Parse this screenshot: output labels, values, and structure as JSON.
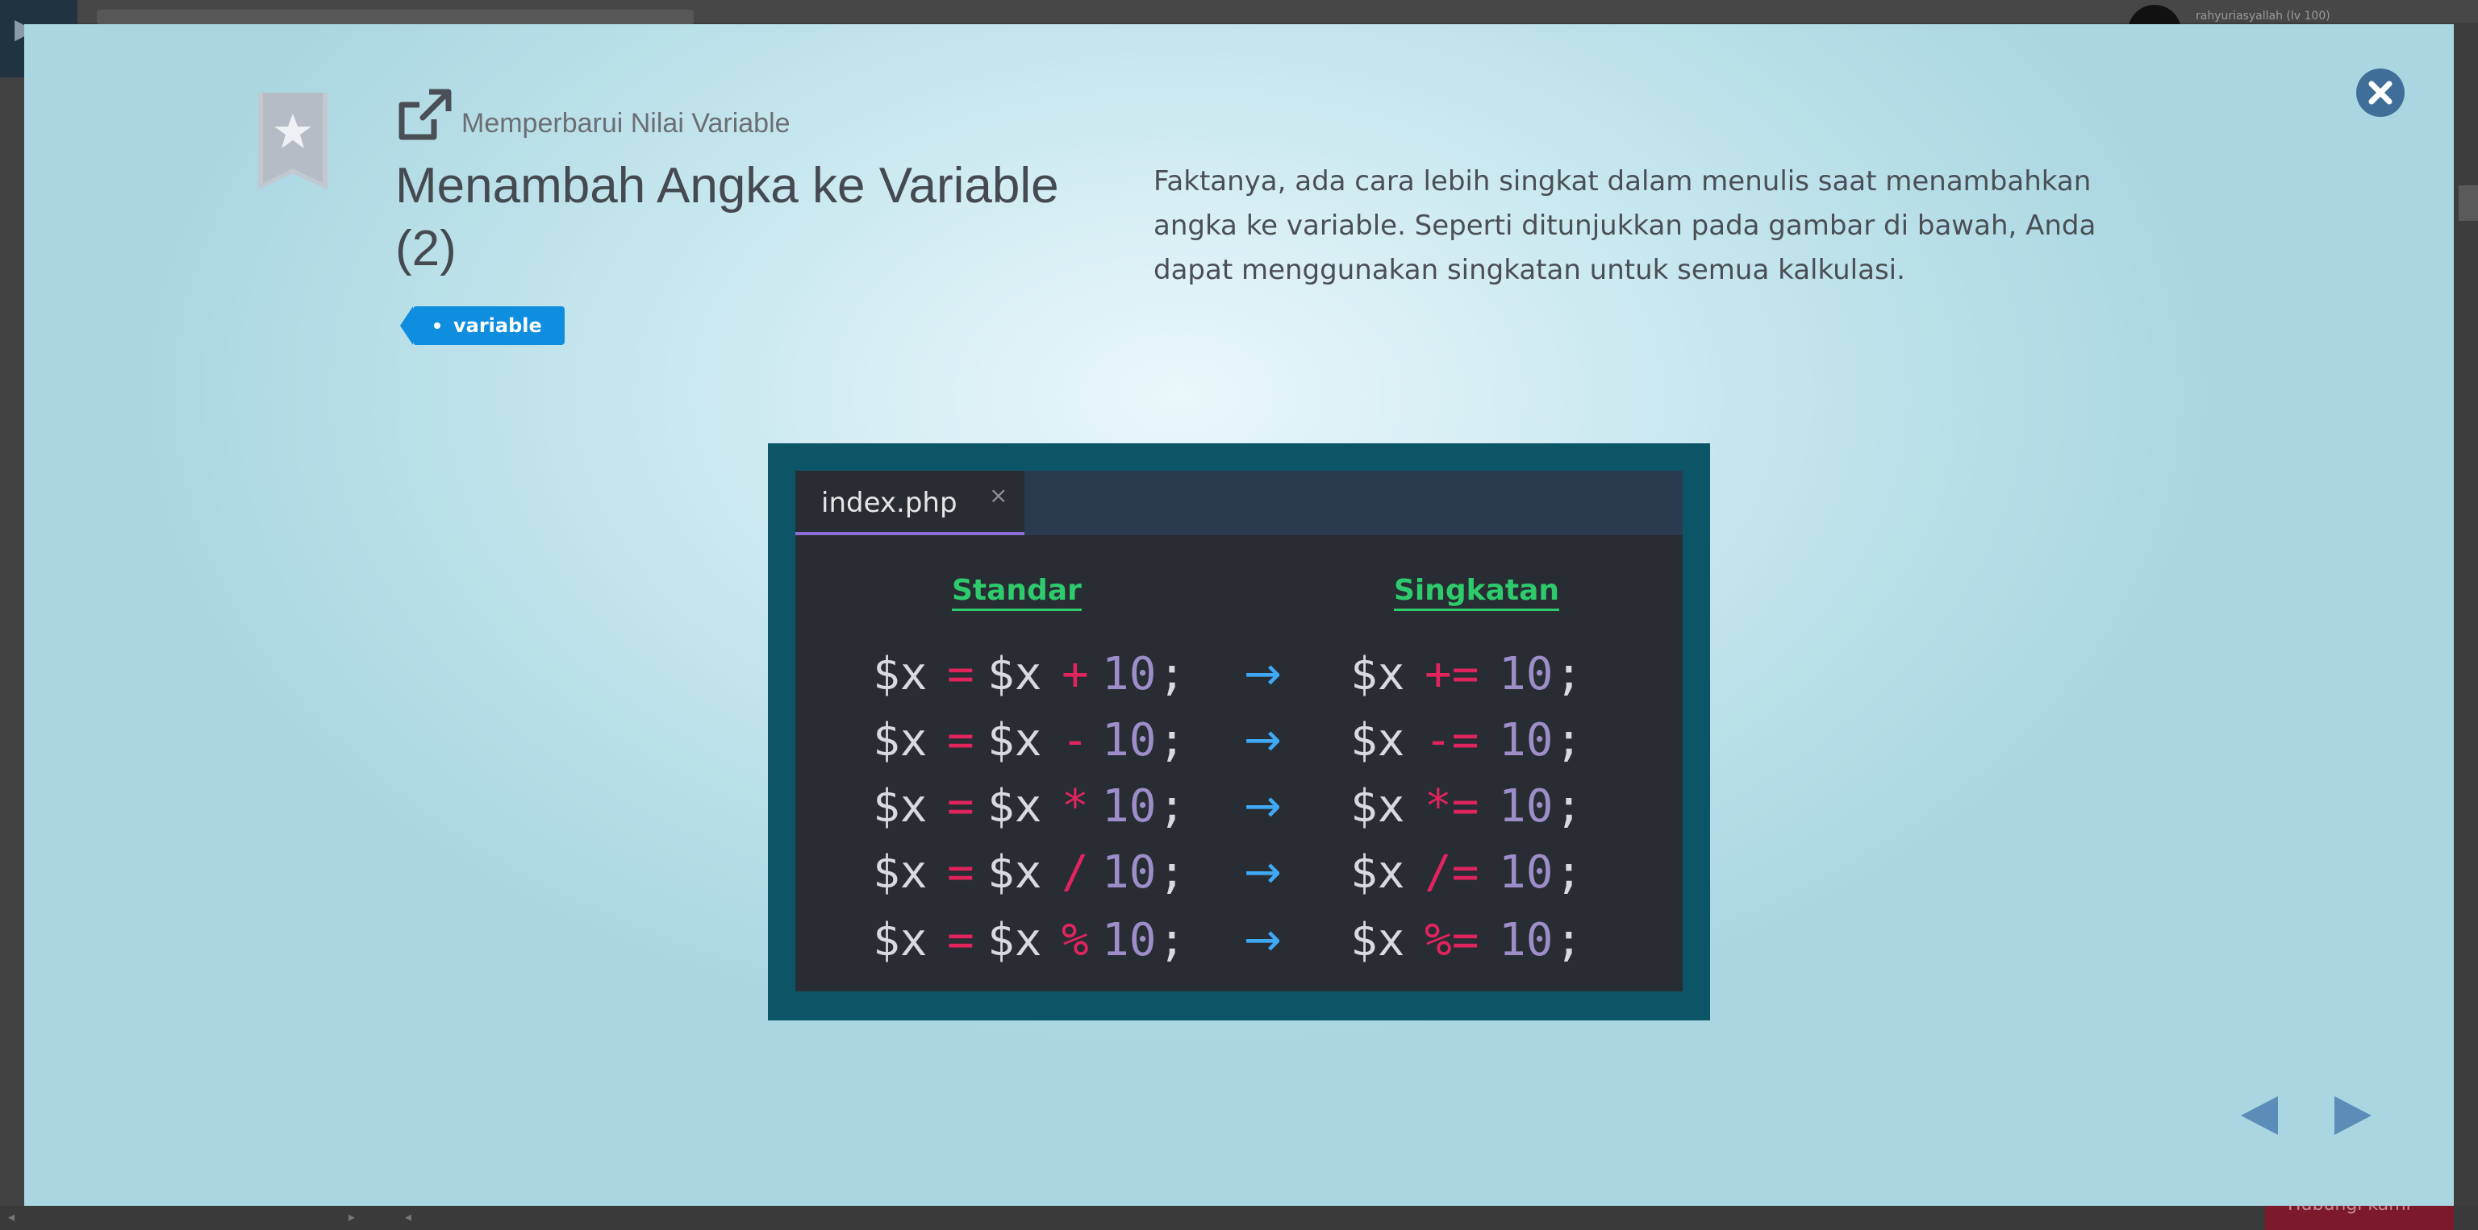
{
  "background": {
    "username": "rahyuriasyallah (lv 100)",
    "bottom_button_label": "Hubungi kami"
  },
  "lesson": {
    "section": "Memperbarui Nilai Variable",
    "title": "Menambah Angka ke Variable (2)",
    "tag": "variable",
    "description": "Faktanya, ada cara lebih singkat dalam menulis saat menambahkan angka ke variable. Seperti ditunjukkan pada gambar di bawah, Anda dapat menggunakan singkatan untuk semua kalkulasi."
  },
  "code_image": {
    "tab_name": "index.php",
    "tab_close": "×",
    "col_standard": "Standar",
    "col_short": "Singkatan",
    "arrow": "→",
    "rows": [
      {
        "std_a": "$x",
        "std_eq": "=",
        "std_b": "$x",
        "std_op": "+",
        "std_num": "10",
        "std_semi": ";",
        "sh_var": "$x",
        "sh_op": "+=",
        "sh_num": "10",
        "sh_semi": ";"
      },
      {
        "std_a": "$x",
        "std_eq": "=",
        "std_b": "$x",
        "std_op": "-",
        "std_num": "10",
        "std_semi": ";",
        "sh_var": "$x",
        "sh_op": "-=",
        "sh_num": "10",
        "sh_semi": ";"
      },
      {
        "std_a": "$x",
        "std_eq": "=",
        "std_b": "$x",
        "std_op": "*",
        "std_num": "10",
        "std_semi": ";",
        "sh_var": "$x",
        "sh_op": "*=",
        "sh_num": "10",
        "sh_semi": ";"
      },
      {
        "std_a": "$x",
        "std_eq": "=",
        "std_b": "$x",
        "std_op": "/",
        "std_num": "10",
        "std_semi": ";",
        "sh_var": "$x",
        "sh_op": "/=",
        "sh_num": "10",
        "sh_semi": ";"
      },
      {
        "std_a": "$x",
        "std_eq": "=",
        "std_b": "$x",
        "std_op": "%",
        "std_num": "10",
        "std_semi": ";",
        "sh_var": "$x",
        "sh_op": "%=",
        "sh_num": "10",
        "sh_semi": ";"
      }
    ]
  },
  "colors": {
    "tag_blue": "#0f8ee0",
    "code_green": "#2ecb6c",
    "code_red": "#e0245e",
    "code_purple": "#9d8ec9",
    "arrow_blue": "#3fa9f5",
    "nav_blue": "#5b8db8"
  },
  "icons": {
    "bookmark": "bookmark-star-icon",
    "section": "external-link-icon",
    "close": "close-circle-icon",
    "prev": "triangle-left-icon",
    "next": "triangle-right-icon"
  }
}
